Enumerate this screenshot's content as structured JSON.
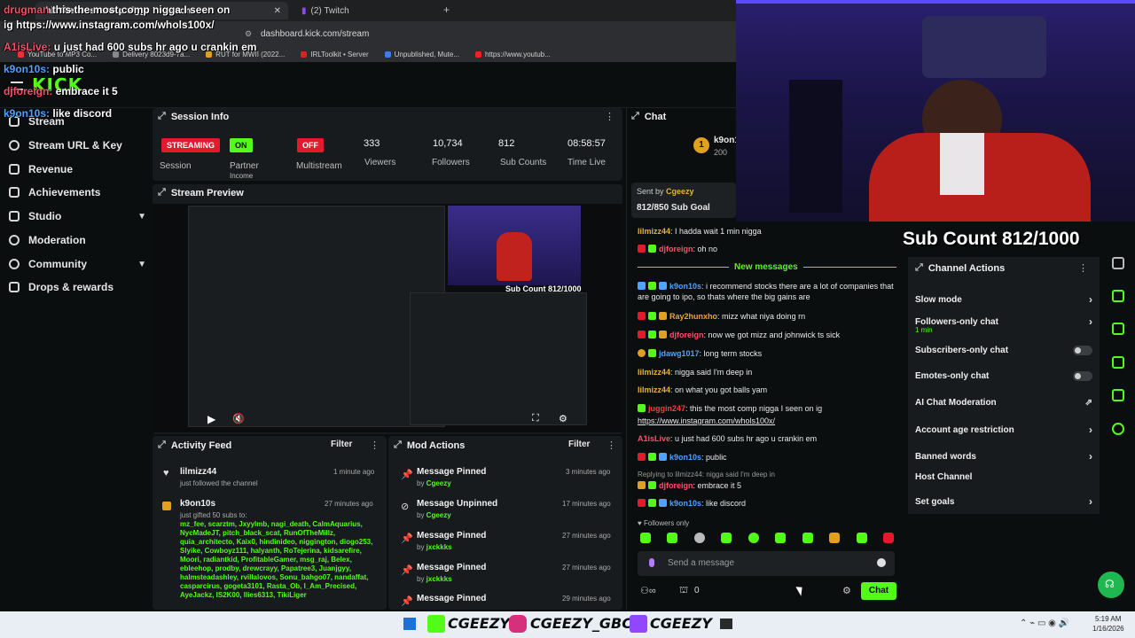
{
  "browser": {
    "tabs": [
      {
        "label": "this the most comp nigga I seen on"
      },
      {
        "label": "(2) Twitch"
      }
    ],
    "url": "dashboard.kick.com/stream",
    "bookmarks": [
      "YouTube to MP3 Co...",
      "Delivery 8023d9-7a...",
      "RUT for MWII (2022...",
      "IRLToolkit • Server",
      "Unpublished, Mute...",
      "https://www.youtub..."
    ]
  },
  "logo": "KICK",
  "sidebar": {
    "items": [
      {
        "label": "Stream",
        "expandable": false
      },
      {
        "label": "Stream URL & Key",
        "expandable": false
      },
      {
        "label": "Revenue",
        "expandable": false
      },
      {
        "label": "Achievements",
        "expandable": false
      },
      {
        "label": "Studio",
        "expandable": true
      },
      {
        "label": "Moderation",
        "expandable": false
      },
      {
        "label": "Community",
        "expandable": true
      },
      {
        "label": "Drops & rewards",
        "expandable": false
      }
    ]
  },
  "session_info": {
    "title": "Session Info",
    "session": {
      "badge": "STREAMING",
      "label": "Session"
    },
    "partner": {
      "badge": "ON",
      "label": "Partner",
      "sublabel": "Income"
    },
    "multistream": {
      "badge": "OFF",
      "label": "Multistream"
    },
    "viewers": {
      "value": "333",
      "label": "Viewers"
    },
    "followers": {
      "value": "10,734",
      "label": "Followers"
    },
    "subs": {
      "value": "812",
      "label": "Sub Counts"
    },
    "time": {
      "value": "08:58:57",
      "label": "Time Live"
    }
  },
  "stream_preview": {
    "title": "Stream Preview",
    "overlay_text": "Sub Count 812/1000"
  },
  "activity_feed": {
    "title": "Activity Feed",
    "filter": "Filter",
    "items": [
      {
        "name": "lilmizz44",
        "sub": "just followed the channel",
        "time": "1 minute ago"
      },
      {
        "name": "k9on10s",
        "sub": "just gifted 50 subs to:",
        "time": "27 minutes ago",
        "list": "mz_fee, scarztm, Jxyylmb, nagi_death, CalmAquarius, NycMadeJT, pitch_black_scat, RunOfTheMillz, quia_architecto, Kaix0, hindinideo, niggington, diogo253, Slyike, Cowboyz111, halyanth, RoTejerina, kidsarefire, Moori, radiantkid, ProfitableGamer, msg_raj, Belex, ebleehop, prodby, drewcrayy, Papatree3, Juanjgyy, halmsteadashley, rvillalovos, Sonu_bahgo07, nandaffat, casparcirus, gogeta3101, Rasta_Ob, l_Am_Precised, AyeJackz, IS2K00, llies6313, TikiLiger"
      }
    ]
  },
  "mod_actions": {
    "title": "Mod Actions",
    "filter": "Filter",
    "items": [
      {
        "action": "Message Pinned",
        "by": "Cgeezy",
        "time": "3 minutes ago",
        "icon": "pin-icon"
      },
      {
        "action": "Message Unpinned",
        "by": "Cgeezy",
        "time": "17 minutes ago",
        "icon": "unpin-icon"
      },
      {
        "action": "Message Pinned",
        "by": "jxckkks",
        "time": "27 minutes ago",
        "icon": "pin-icon"
      },
      {
        "action": "Message Pinned",
        "by": "jxckkks",
        "time": "27 minutes ago",
        "icon": "pin-icon"
      },
      {
        "action": "Message Pinned",
        "by": "",
        "time": "29 minutes ago",
        "icon": "pin-icon"
      }
    ]
  },
  "chat": {
    "title": "Chat",
    "pinned_user": "k9on1",
    "pinned_count": "200",
    "sent_by": "Sent by",
    "sent_user": "Cgeezy",
    "sub_goal": "812/850 Sub Goal",
    "new_messages": "New messages",
    "messages": [
      {
        "user": "lilmizz44",
        "color": "#e6b33a",
        "text": "I hadda wait 1 min nigga"
      },
      {
        "user": "djforeign",
        "color": "#ff4d6d",
        "text": "oh no"
      },
      {
        "user": "k9on10s",
        "color": "#4ea3ff",
        "text": "i recommend stocks there are a lot of companies that are going to ipo, so thats where the big gains are"
      },
      {
        "user": "Ray2hunxho",
        "color": "#f0a23a",
        "text": "mizz what niya doing rn"
      },
      {
        "user": "djforeign",
        "color": "#ff4d6d",
        "text": "now we got mizz and johnwick ts sick"
      },
      {
        "user": "jdawg1017",
        "color": "#4ea3ff",
        "text": "long term stocks"
      },
      {
        "user": "lilmizz44",
        "color": "#e6b33a",
        "text": "nigga said I'm deep in"
      },
      {
        "user": "lilmizz44",
        "color": "#e6b33a",
        "text": "on what you got balls yam"
      },
      {
        "user": "juggin247",
        "color": "#ff3b3b",
        "text": "this the most comp nigga I seen on ig"
      },
      {
        "user": "A1isLive",
        "color": "#ff4d6d",
        "text": "u just had 600 subs hr ago u crankin em"
      },
      {
        "user": "k9on10s",
        "color": "#4ea3ff",
        "text": "public"
      },
      {
        "user": "djforeign",
        "color": "#ff4d6d",
        "text": "embrace it 5"
      },
      {
        "user": "k9on10s",
        "color": "#4ea3ff",
        "text": "like discord"
      }
    ],
    "link": "https://www.instagram.com/whols100x/",
    "reply_hint": "Replying to lilmizz44: nigga said I'm deep in",
    "followers_only": "Followers only",
    "placeholder": "Send a message",
    "points": "0",
    "send_label": "Chat"
  },
  "channel_actions": {
    "title": "Channel Actions",
    "overlay_sub": "Sub Count 812/1000",
    "items": [
      {
        "label": "Slow mode",
        "control": "arrow"
      },
      {
        "label": "Followers-only chat",
        "sub": "1 min",
        "control": "arrow"
      },
      {
        "label": "Subscribers-only chat",
        "control": "toggle"
      },
      {
        "label": "Emotes-only chat",
        "control": "toggle"
      },
      {
        "label": "AI Chat Moderation",
        "control": "external"
      },
      {
        "label": "Account age restriction",
        "control": "arrow"
      },
      {
        "label": "Banned words",
        "control": "arrow"
      },
      {
        "label": "Host Channel",
        "control": "none"
      },
      {
        "label": "Set goals",
        "control": "arrow"
      }
    ]
  },
  "overlay_chat": [
    {
      "user": "drugman",
      "text": "this the most comp nigga I seen on"
    },
    {
      "user": "",
      "text": "ig https://www.instagram.com/whols100x/"
    },
    {
      "user": "A1isLive:",
      "text": "u just had 600 subs hr ago u crankin em"
    },
    {
      "user": "k9on10s:",
      "text": "public"
    },
    {
      "user": "djforeign:",
      "text": "embrace it 5"
    },
    {
      "user": "k9on10s:",
      "text": "like discord"
    }
  ],
  "taskbar": {
    "socials": [
      "CGEEZY",
      "CGEEZY_GBC",
      "CGEEZY"
    ],
    "time": "5:19 AM",
    "date": "1/16/2026"
  },
  "colors": {
    "kick_green": "#53fc18",
    "red": "#e3192c",
    "panel": "#181b1d",
    "bg": "#0b0e0f"
  }
}
